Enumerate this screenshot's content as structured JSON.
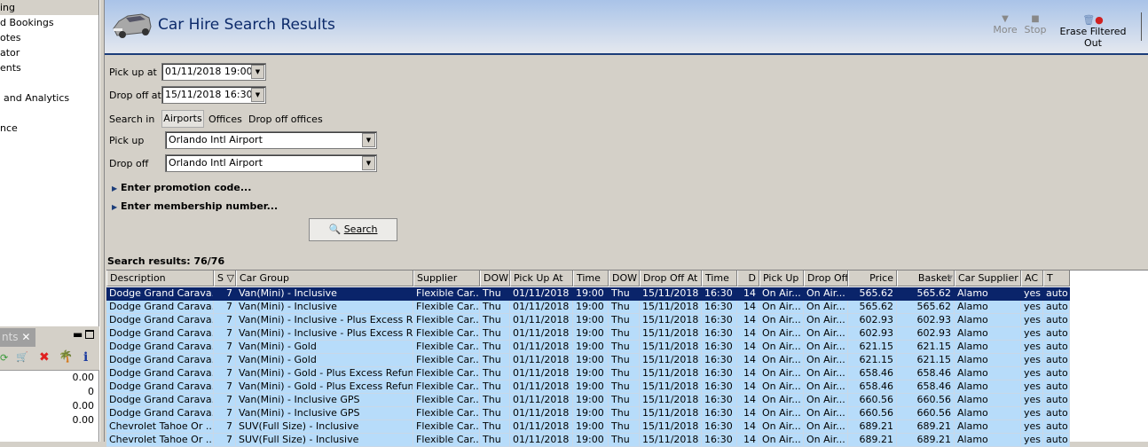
{
  "sidebar": {
    "items": [
      "ing",
      "d Bookings",
      "otes",
      "ator",
      "ents",
      "",
      "and Analytics",
      "",
      "nce"
    ]
  },
  "panel": {
    "tab_label": "nts",
    "values": [
      "0.00",
      "0",
      "0.00",
      "0.00"
    ]
  },
  "header": {
    "title": "Car Hire Search Results",
    "toolbar": {
      "more": "More",
      "stop": "Stop",
      "erase": "Erase Filtered Out"
    }
  },
  "form": {
    "pickup_at_label": "Pick up at",
    "pickup_at": "01/11/2018 19:00",
    "dropoff_at_label": "Drop off at",
    "dropoff_at": "15/11/2018 16:30",
    "search_in_label": "Search in",
    "search_in_options": [
      "Airports",
      "Offices",
      "Drop off offices"
    ],
    "pickup_label": "Pick up",
    "pickup": "Orlando Intl Airport",
    "dropoff_label": "Drop off",
    "dropoff": "Orlando Intl Airport",
    "promo": "Enter promotion code...",
    "membership": "Enter membership number...",
    "search_button": "Search"
  },
  "results": {
    "summary": "Search results: 76/76",
    "columns": [
      "Description",
      "S",
      "Car Group",
      "Supplier",
      "DOW",
      "Pick Up At",
      "Time",
      "DOW",
      "Drop Off At",
      "Time",
      "D",
      "Pick Up",
      "Drop Off",
      "Price",
      "Basket",
      "Car Supplier",
      "AC",
      "T"
    ],
    "rows": [
      [
        "Dodge Grand Carava...",
        "7",
        "Van(Mini) - Inclusive",
        "Flexible Car...",
        "Thu",
        "01/11/2018",
        "19:00",
        "Thu",
        "15/11/2018",
        "16:30",
        "14",
        "On Air...",
        "On Air...",
        "565.62",
        "565.62",
        "Alamo",
        "yes",
        "auto"
      ],
      [
        "Dodge Grand Carava...",
        "7",
        "Van(Mini) - Inclusive",
        "Flexible Car...",
        "Thu",
        "01/11/2018",
        "19:00",
        "Thu",
        "15/11/2018",
        "16:30",
        "14",
        "On Air...",
        "On Air...",
        "565.62",
        "565.62",
        "Alamo",
        "yes",
        "auto"
      ],
      [
        "Dodge Grand Carava...",
        "7",
        "Van(Mini) - Inclusive - Plus Excess Ref...",
        "Flexible Car...",
        "Thu",
        "01/11/2018",
        "19:00",
        "Thu",
        "15/11/2018",
        "16:30",
        "14",
        "On Air...",
        "On Air...",
        "602.93",
        "602.93",
        "Alamo",
        "yes",
        "auto"
      ],
      [
        "Dodge Grand Carava...",
        "7",
        "Van(Mini) - Inclusive - Plus Excess Ref...",
        "Flexible Car...",
        "Thu",
        "01/11/2018",
        "19:00",
        "Thu",
        "15/11/2018",
        "16:30",
        "14",
        "On Air...",
        "On Air...",
        "602.93",
        "602.93",
        "Alamo",
        "yes",
        "auto"
      ],
      [
        "Dodge Grand Carava...",
        "7",
        "Van(Mini) - Gold",
        "Flexible Car...",
        "Thu",
        "01/11/2018",
        "19:00",
        "Thu",
        "15/11/2018",
        "16:30",
        "14",
        "On Air...",
        "On Air...",
        "621.15",
        "621.15",
        "Alamo",
        "yes",
        "auto"
      ],
      [
        "Dodge Grand Carava...",
        "7",
        "Van(Mini) - Gold",
        "Flexible Car...",
        "Thu",
        "01/11/2018",
        "19:00",
        "Thu",
        "15/11/2018",
        "16:30",
        "14",
        "On Air...",
        "On Air...",
        "621.15",
        "621.15",
        "Alamo",
        "yes",
        "auto"
      ],
      [
        "Dodge Grand Carava...",
        "7",
        "Van(Mini) - Gold - Plus Excess Refund",
        "Flexible Car...",
        "Thu",
        "01/11/2018",
        "19:00",
        "Thu",
        "15/11/2018",
        "16:30",
        "14",
        "On Air...",
        "On Air...",
        "658.46",
        "658.46",
        "Alamo",
        "yes",
        "auto"
      ],
      [
        "Dodge Grand Carava...",
        "7",
        "Van(Mini) - Gold - Plus Excess Refund",
        "Flexible Car...",
        "Thu",
        "01/11/2018",
        "19:00",
        "Thu",
        "15/11/2018",
        "16:30",
        "14",
        "On Air...",
        "On Air...",
        "658.46",
        "658.46",
        "Alamo",
        "yes",
        "auto"
      ],
      [
        "Dodge Grand Carava...",
        "7",
        "Van(Mini) - Inclusive GPS",
        "Flexible Car...",
        "Thu",
        "01/11/2018",
        "19:00",
        "Thu",
        "15/11/2018",
        "16:30",
        "14",
        "On Air...",
        "On Air...",
        "660.56",
        "660.56",
        "Alamo",
        "yes",
        "auto"
      ],
      [
        "Dodge Grand Carava...",
        "7",
        "Van(Mini) - Inclusive GPS",
        "Flexible Car...",
        "Thu",
        "01/11/2018",
        "19:00",
        "Thu",
        "15/11/2018",
        "16:30",
        "14",
        "On Air...",
        "On Air...",
        "660.56",
        "660.56",
        "Alamo",
        "yes",
        "auto"
      ],
      [
        "Chevrolet Tahoe Or ...",
        "7",
        "SUV(Full Size) - Inclusive",
        "Flexible Car...",
        "Thu",
        "01/11/2018",
        "19:00",
        "Thu",
        "15/11/2018",
        "16:30",
        "14",
        "On Air...",
        "On Air...",
        "689.21",
        "689.21",
        "Alamo",
        "yes",
        "auto"
      ],
      [
        "Chevrolet Tahoe Or ...",
        "7",
        "SUV(Full Size) - Inclusive",
        "Flexible Car...",
        "Thu",
        "01/11/2018",
        "19:00",
        "Thu",
        "15/11/2018",
        "16:30",
        "14",
        "On Air...",
        "On Air...",
        "689.21",
        "689.21",
        "Alamo",
        "yes",
        "auto"
      ]
    ],
    "selected_row": 0
  },
  "colors": {
    "selection": "#0a246a",
    "row": "#b7dcfa",
    "title": "#0c2a6a"
  }
}
